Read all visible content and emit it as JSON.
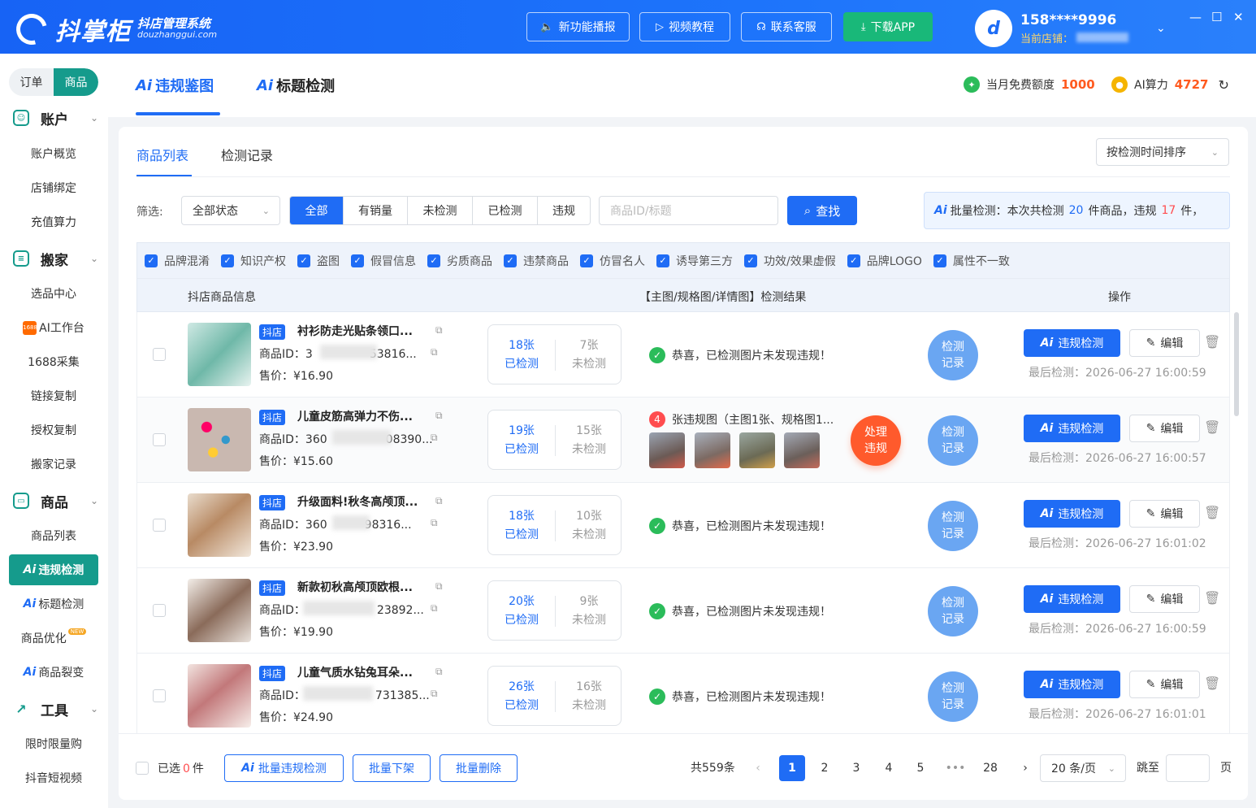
{
  "app": {
    "logo_name": "抖掌柜",
    "logo_sub": "抖店管理系统",
    "logo_domain": "douzhanggui.com",
    "top_buttons": [
      {
        "label": "新功能播报",
        "icon": "speaker-icon"
      },
      {
        "label": "视频教程",
        "icon": "video-icon"
      },
      {
        "label": "联系客服",
        "icon": "headset-icon"
      },
      {
        "label": "下载APP",
        "icon": "download-icon"
      }
    ],
    "user": {
      "phone": "158****9996",
      "store_label": "当前店铺："
    }
  },
  "sidebar": {
    "switch": [
      "订单",
      "商品"
    ],
    "groups": [
      {
        "label": "账户",
        "items": [
          "账户概览",
          "店铺绑定",
          "充值算力"
        ]
      },
      {
        "label": "搬家",
        "items": [
          "选品中心",
          "AI工作台",
          "1688采集",
          "链接复制",
          "授权复制",
          "搬家记录"
        ]
      },
      {
        "label": "商品",
        "items": [
          "商品列表",
          "违规检测",
          "标题检测",
          "商品优化",
          "商品裂变"
        ]
      },
      {
        "label": "工具",
        "items": [
          "限时限量购",
          "抖音短视频"
        ]
      }
    ],
    "ai_prefix": "Ai",
    "badge_1688": "1688",
    "new_badge": "NEW"
  },
  "header": {
    "tabs": [
      {
        "ai": "Ai",
        "label": "违规鉴图"
      },
      {
        "ai": "Ai",
        "label": "标题检测"
      }
    ],
    "free_quota_label": "当月免费额度",
    "free_quota_value": "1000",
    "ai_power_label": "AI算力",
    "ai_power_value": "4727"
  },
  "content": {
    "subtabs": [
      "商品列表",
      "检测记录"
    ],
    "sort": "按检测时间排序",
    "filter_label": "筛选:",
    "state_select": "全部状态",
    "segments": [
      "全部",
      "有销量",
      "未检测",
      "已检测",
      "违规"
    ],
    "search_placeholder": "商品ID/标题",
    "search_button": "查找",
    "batch": {
      "prefix": "批量检测：本次共检测",
      "total": "20",
      "mid": "件商品，违规",
      "viol": "17",
      "suffix": "件，"
    },
    "checks": [
      "品牌混淆",
      "知识产权",
      "盗图",
      "假冒信息",
      "劣质商品",
      "违禁商品",
      "仿冒名人",
      "诱导第三方",
      "功效/效果虚假",
      "品牌LOGO",
      "属性不一致"
    ],
    "columns": {
      "info": "抖店商品信息",
      "result": "【主图/规格图/详情图】检测结果",
      "ops": "操作"
    }
  },
  "rows": [
    {
      "tag": "抖店",
      "title": "衬衫防走光贴条领口...",
      "pid_label": "商品ID：",
      "pid_head": "3",
      "pid_tail": "53816...",
      "price": "售价：¥16.90",
      "checked": "18张",
      "checked_label": "已检测",
      "unchecked": "7张",
      "unchecked_label": "未检测",
      "result": "恭喜，已检测图片未发现违规！",
      "last": "最后检测：2026-06-27 16:00:59"
    },
    {
      "tag": "抖店",
      "title": "儿童皮筋高弹力不伤...",
      "pid_label": "商品ID：",
      "pid_head": "360",
      "pid_tail": "08390...",
      "price": "售价：¥15.60",
      "checked": "19张",
      "checked_label": "已检测",
      "unchecked": "15张",
      "unchecked_label": "未检测",
      "viol_count": "4",
      "result": "张违规图（主图1张、规格图1...",
      "handle": "处理违规",
      "last": "最后检测：2026-06-27 16:00:57"
    },
    {
      "tag": "抖店",
      "title": "升级面料!秋冬高颅顶...",
      "pid_label": "商品ID：",
      "pid_head": "360",
      "pid_tail": "98316...",
      "price": "售价：¥23.90",
      "checked": "18张",
      "checked_label": "已检测",
      "unchecked": "10张",
      "unchecked_label": "未检测",
      "result": "恭喜，已检测图片未发现违规！",
      "last": "最后检测：2026-06-27 16:01:02"
    },
    {
      "tag": "抖店",
      "title": "新款初秋高颅顶欧根...",
      "pid_label": "商品ID：",
      "pid_head": "",
      "pid_tail": "23892...",
      "price": "售价：¥19.90",
      "checked": "20张",
      "checked_label": "已检测",
      "unchecked": "9张",
      "unchecked_label": "未检测",
      "result": "恭喜，已检测图片未发现违规！",
      "last": "最后检测：2026-06-27 16:00:59"
    },
    {
      "tag": "抖店",
      "title": "儿童气质水钻兔耳朵...",
      "pid_label": "商品ID：",
      "pid_head": "",
      "pid_tail": "731385...",
      "price": "售价：¥24.90",
      "checked": "26张",
      "checked_label": "已检测",
      "unchecked": "16张",
      "unchecked_label": "未检测",
      "result": "恭喜，已检测图片未发现违规！",
      "last": "最后检测：2026-06-27 16:01:01"
    }
  ],
  "row_actions": {
    "record": "检测记录",
    "check_ai": "Ai",
    "check": "违规检测",
    "edit": "编辑"
  },
  "footer": {
    "selected_prefix": "已选",
    "selected_count": "0",
    "selected_suffix": "件",
    "batch_check_ai": "Ai",
    "batch_check": "批量违规检测",
    "batch_off": "批量下架",
    "batch_delete": "批量删除",
    "total": "共559条",
    "pages": [
      "1",
      "2",
      "3",
      "4",
      "5",
      "•••",
      "28"
    ],
    "page_size": "20 条/页",
    "jump_label": "跳至",
    "page_unit": "页"
  }
}
